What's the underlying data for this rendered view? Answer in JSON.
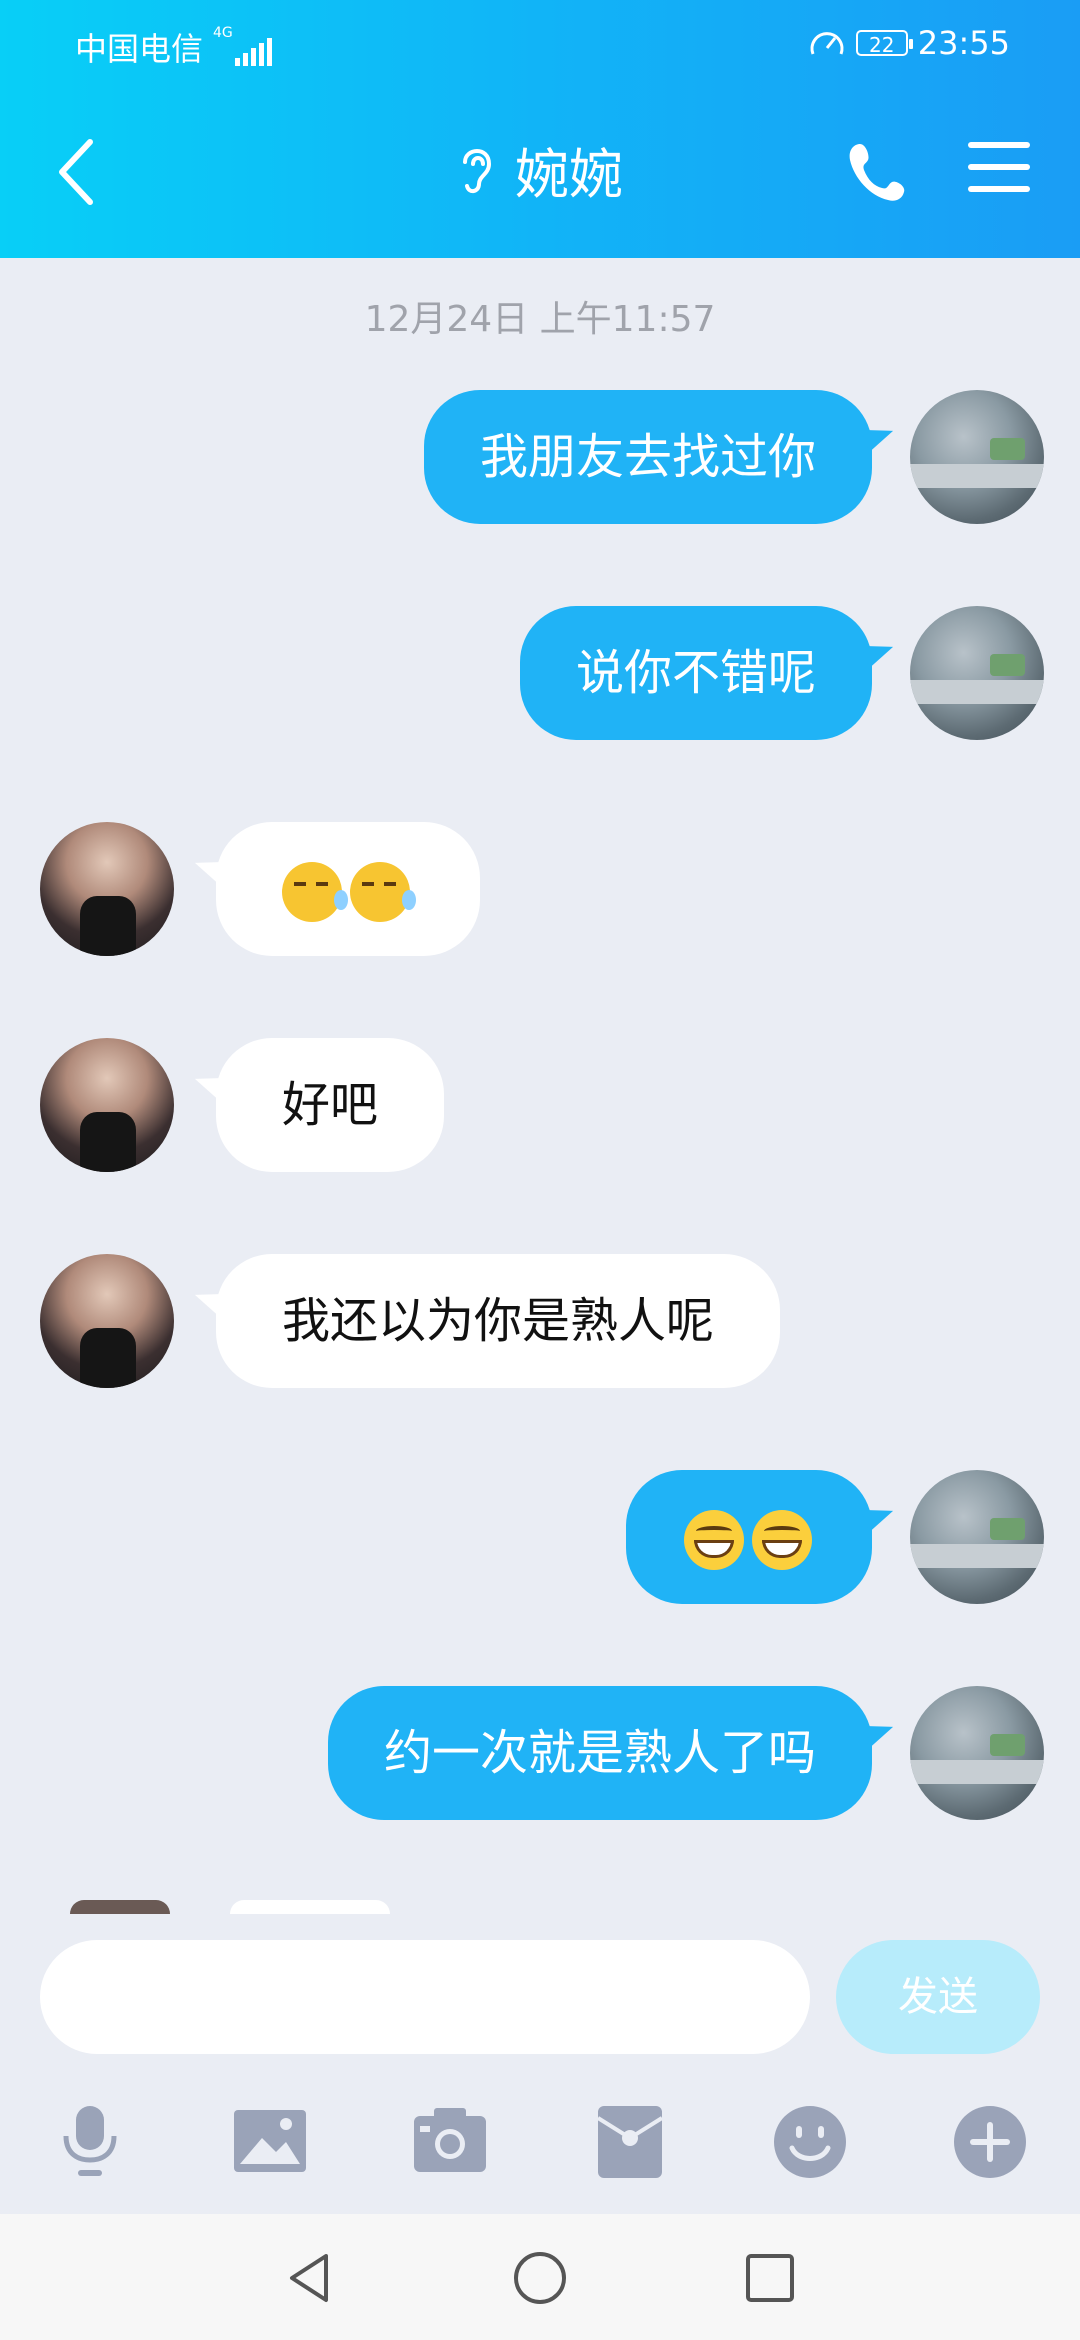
{
  "status_bar": {
    "carrier": "中国电信",
    "network": "4G",
    "battery": "22",
    "time": "23:55"
  },
  "header": {
    "title": "婉婉"
  },
  "conversation": {
    "timestamp": "12月24日 上午11:57",
    "messages": [
      {
        "side": "out",
        "text": "我朋友去找过你"
      },
      {
        "side": "out",
        "text": "说你不错呢"
      },
      {
        "side": "in",
        "emojis": [
          "sly-sweat-emoji",
          "sly-sweat-emoji"
        ]
      },
      {
        "side": "in",
        "text": "好吧"
      },
      {
        "side": "in",
        "text": "我还以为你是熟人呢"
      },
      {
        "side": "out",
        "emojis": [
          "grin-emoji",
          "grin-emoji"
        ]
      },
      {
        "side": "out",
        "text": "约一次就是熟人了吗"
      }
    ]
  },
  "composer": {
    "send_label": "发送",
    "input_value": ""
  },
  "toolbar": {
    "icons": [
      "microphone-icon",
      "image-icon",
      "camera-icon",
      "red-packet-icon",
      "emoji-icon",
      "plus-icon"
    ]
  },
  "navbar": {
    "icons": [
      "back-triangle-icon",
      "home-circle-icon",
      "recents-square-icon"
    ]
  },
  "colors": {
    "accent": "#20b3f6",
    "header_start": "#08cff7",
    "header_end": "#1a9df5",
    "background": "#eaedf4"
  }
}
